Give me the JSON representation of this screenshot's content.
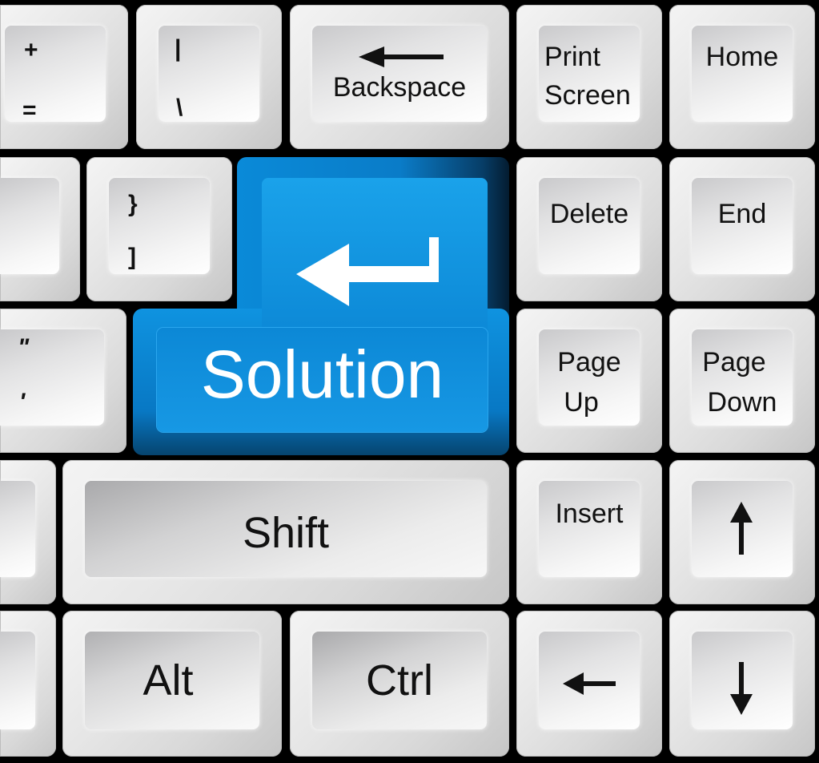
{
  "keys": {
    "plus_equals": {
      "top": "+",
      "bottom": "="
    },
    "pipe_backslash": {
      "top": "|",
      "bottom": "\\"
    },
    "backspace": {
      "label": "Backspace",
      "icon": "left-arrow-icon"
    },
    "print_screen": {
      "line1": "Print",
      "line2": "Screen"
    },
    "home": {
      "label": "Home"
    },
    "brace_bracket": {
      "top": "}",
      "bottom": "]"
    },
    "enter": {
      "label": "Solution",
      "icon": "enter-return-arrow-icon",
      "color": "#0a8ad8"
    },
    "delete": {
      "label": "Delete"
    },
    "end": {
      "label": "End"
    },
    "quote": {
      "top": "\"",
      "bottom": "'"
    },
    "page_up": {
      "line1": "Page",
      "line2": "Up"
    },
    "page_down": {
      "line1": "Page",
      "line2": "Down"
    },
    "shift": {
      "label": "Shift"
    },
    "insert": {
      "label": "Insert"
    },
    "arrow_up": {
      "icon": "up-arrow-icon"
    },
    "alt": {
      "label": "Alt"
    },
    "ctrl": {
      "label": "Ctrl"
    },
    "arrow_left": {
      "icon": "left-arrow-icon"
    },
    "arrow_down": {
      "icon": "down-arrow-icon"
    }
  },
  "colors": {
    "background": "#000000",
    "key": "#e6e6e6",
    "accent_blue": "#0a8ad8",
    "text": "#111111"
  }
}
